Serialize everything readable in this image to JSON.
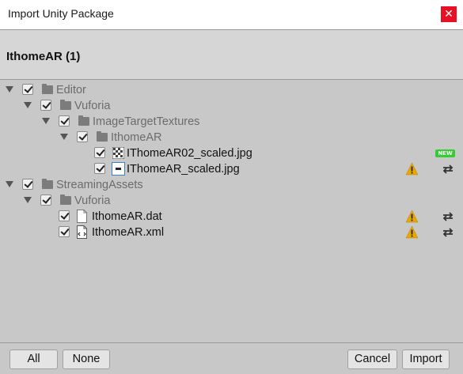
{
  "window": {
    "title": "Import Unity Package",
    "close_glyph": "✕"
  },
  "header": {
    "title": "IthomeAR (1)"
  },
  "tree": [
    {
      "label": "Editor",
      "type": "folder",
      "checked": true
    },
    {
      "label": "Vuforia",
      "type": "folder",
      "checked": true
    },
    {
      "label": "ImageTargetTextures",
      "type": "folder",
      "checked": true
    },
    {
      "label": "IthomeAR",
      "type": "folder",
      "checked": true
    },
    {
      "label": "IThomeAR02_scaled.jpg",
      "type": "image-file",
      "checked": true,
      "badge": "NEW"
    },
    {
      "label": "IThomeAR_scaled.jpg",
      "type": "image-file",
      "checked": true,
      "warning": true,
      "changed": true
    },
    {
      "label": "StreamingAssets",
      "type": "folder",
      "checked": true
    },
    {
      "label": "Vuforia",
      "type": "folder",
      "checked": true
    },
    {
      "label": "IthomeAR.dat",
      "type": "file",
      "checked": true,
      "warning": true,
      "changed": true
    },
    {
      "label": "IthomeAR.xml",
      "type": "xml-file",
      "checked": true,
      "warning": true,
      "changed": true
    }
  ],
  "footer": {
    "all_label": "All",
    "none_label": "None",
    "cancel_label": "Cancel",
    "import_label": "Import"
  },
  "colors": {
    "close_button": "#e81123",
    "new_badge": "#33cc33",
    "warning": "#e8a800",
    "folder": "#7c7c7c"
  }
}
